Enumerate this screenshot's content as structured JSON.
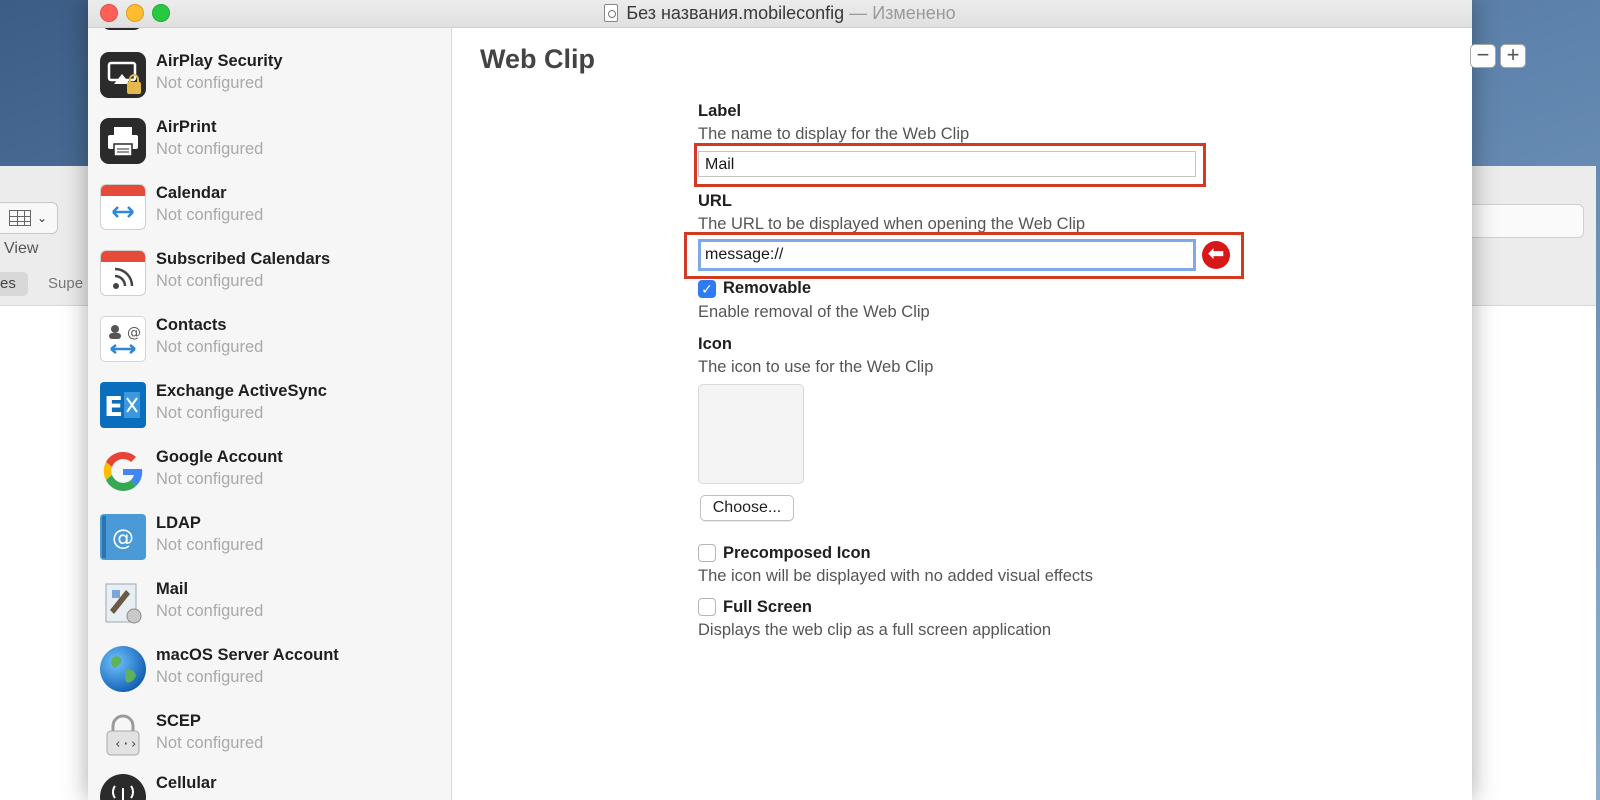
{
  "background_window": {
    "view_label": "View",
    "tab_1": "es",
    "tab_2": "Supe"
  },
  "window": {
    "title": "Без названия.mobileconfig",
    "title_separator": " — ",
    "title_status": "Изменено"
  },
  "sidebar": {
    "items": [
      {
        "name": "AirPlay Security",
        "status": "Not configured",
        "icon": "airplay-security-icon"
      },
      {
        "name": "AirPrint",
        "status": "Not configured",
        "icon": "printer-icon"
      },
      {
        "name": "Calendar",
        "status": "Not configured",
        "icon": "calendar-icon"
      },
      {
        "name": "Subscribed Calendars",
        "status": "Not configured",
        "icon": "subscribed-calendar-icon"
      },
      {
        "name": "Contacts",
        "status": "Not configured",
        "icon": "contacts-icon"
      },
      {
        "name": "Exchange ActiveSync",
        "status": "Not configured",
        "icon": "exchange-icon"
      },
      {
        "name": "Google Account",
        "status": "Not configured",
        "icon": "google-icon"
      },
      {
        "name": "LDAP",
        "status": "Not configured",
        "icon": "ldap-icon"
      },
      {
        "name": "Mail",
        "status": "Not configured",
        "icon": "mail-icon"
      },
      {
        "name": "macOS Server Account",
        "status": "Not configured",
        "icon": "globe-icon"
      },
      {
        "name": "SCEP",
        "status": "Not configured",
        "icon": "scep-lock-icon"
      },
      {
        "name": "Cellular",
        "status": "",
        "icon": "cellular-icon"
      }
    ]
  },
  "content": {
    "section_title": "Web Clip",
    "minus_label": "−",
    "plus_label": "+",
    "label_field": {
      "title": "Label",
      "description": "The name to display for the Web Clip",
      "value": "Mail"
    },
    "url_field": {
      "title": "URL",
      "description": "The URL to be displayed when opening the Web Clip",
      "value": "message://"
    },
    "removable": {
      "title": "Removable",
      "description": "Enable removal of the Web Clip",
      "checked": true
    },
    "icon_field": {
      "title": "Icon",
      "description": "The icon to use for the Web Clip",
      "choose_label": "Choose..."
    },
    "precomposed": {
      "title": "Precomposed Icon",
      "description": "The icon will be displayed with no added visual effects",
      "checked": false
    },
    "full_screen": {
      "title": "Full Screen",
      "description": "Displays the web clip as a full screen application",
      "checked": false
    }
  },
  "colors": {
    "highlight_border": "#d23b22",
    "error_icon": "#d81818",
    "checkbox_checked": "#2d7cf6",
    "focus_ring": "#7fa9e8"
  }
}
